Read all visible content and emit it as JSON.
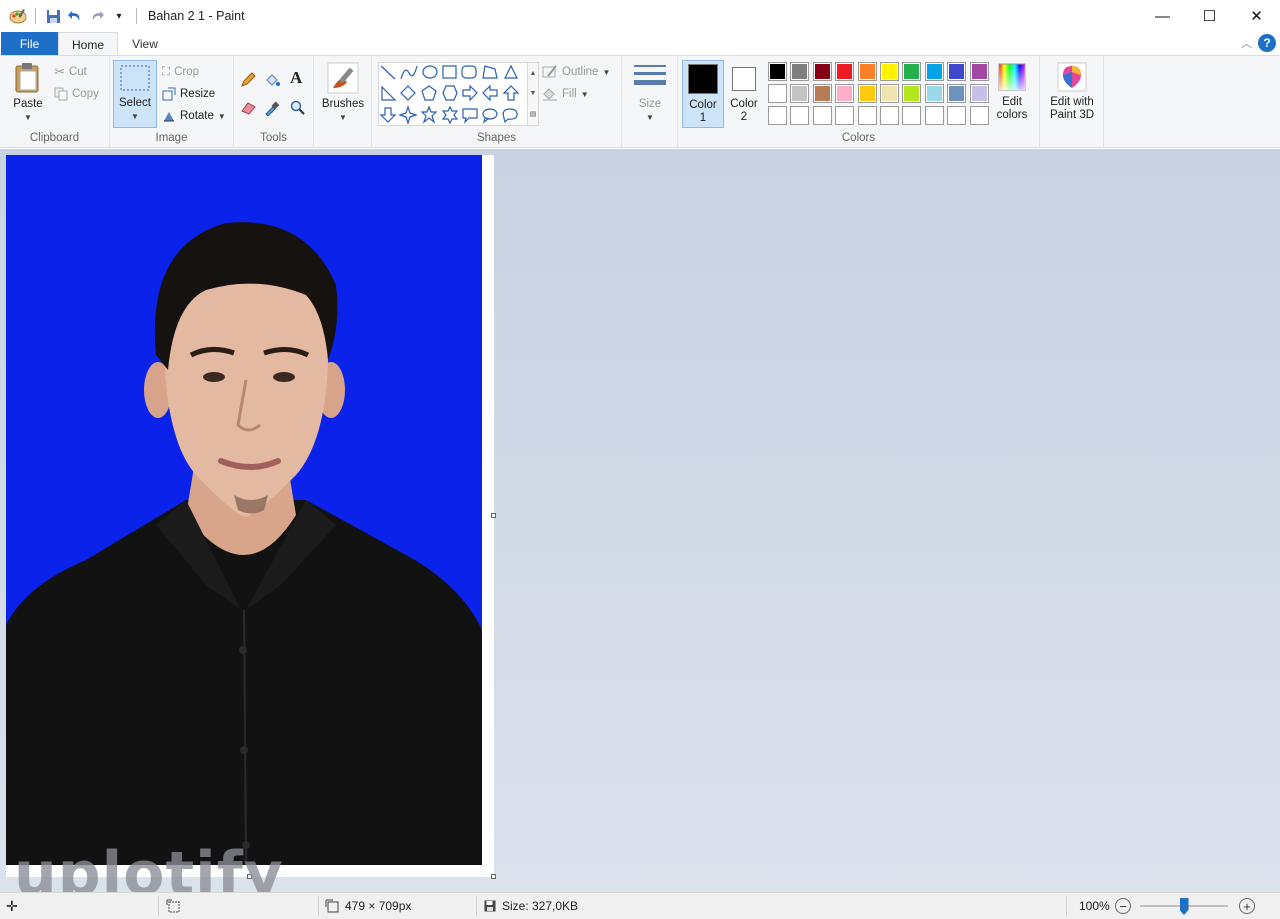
{
  "window": {
    "title": "Bahan 2 1 - Paint",
    "controls": {
      "minimize": "—",
      "maximize": "☐",
      "close": "✕"
    }
  },
  "quick_access": {
    "customize": "▾"
  },
  "tabs": {
    "file": "File",
    "home": "Home",
    "view": "View"
  },
  "help_label": "?",
  "ribbon": {
    "clipboard": {
      "label": "Clipboard",
      "paste": "Paste",
      "cut": "Cut",
      "copy": "Copy"
    },
    "image": {
      "label": "Image",
      "select": "Select",
      "crop": "Crop",
      "resize": "Resize",
      "rotate": "Rotate"
    },
    "tools": {
      "label": "Tools"
    },
    "brushes": {
      "label": "Brushes"
    },
    "shapes": {
      "label": "Shapes",
      "outline": "Outline",
      "fill": "Fill"
    },
    "size": {
      "label": "Size"
    },
    "colors": {
      "label": "Colors",
      "color1": "Color\n1",
      "color1_line1": "Color",
      "color1_line2": "1",
      "color2_line1": "Color",
      "color2_line2": "2",
      "edit_line1": "Edit",
      "edit_line2": "colors",
      "color1_value": "#000000",
      "color2_value": "#ffffff",
      "palette_row1": [
        "#000000",
        "#7f7f7f",
        "#880015",
        "#ed1c24",
        "#ff7f27",
        "#fff200",
        "#22b14c",
        "#00a2e8",
        "#3f48cc",
        "#a349a4"
      ],
      "palette_row2": [
        "#ffffff",
        "#c3c3c3",
        "#b97a57",
        "#ffaec9",
        "#ffc90e",
        "#efe4b0",
        "#b5e61d",
        "#99d9ea",
        "#7092be",
        "#c8bfe7"
      ],
      "palette_row3": [
        "#ffffff",
        "#ffffff",
        "#ffffff",
        "#ffffff",
        "#ffffff",
        "#ffffff",
        "#ffffff",
        "#ffffff",
        "#ffffff",
        "#ffffff"
      ]
    },
    "paint3d": {
      "line1": "Edit with",
      "line2": "Paint 3D"
    }
  },
  "canvas": {
    "background_color": "#0a22ea",
    "watermark": "uplotify"
  },
  "status": {
    "dimensions": "479 × 709px",
    "size": "Size: 327,0KB",
    "zoom": "100%",
    "zoom_level": 0.5
  }
}
